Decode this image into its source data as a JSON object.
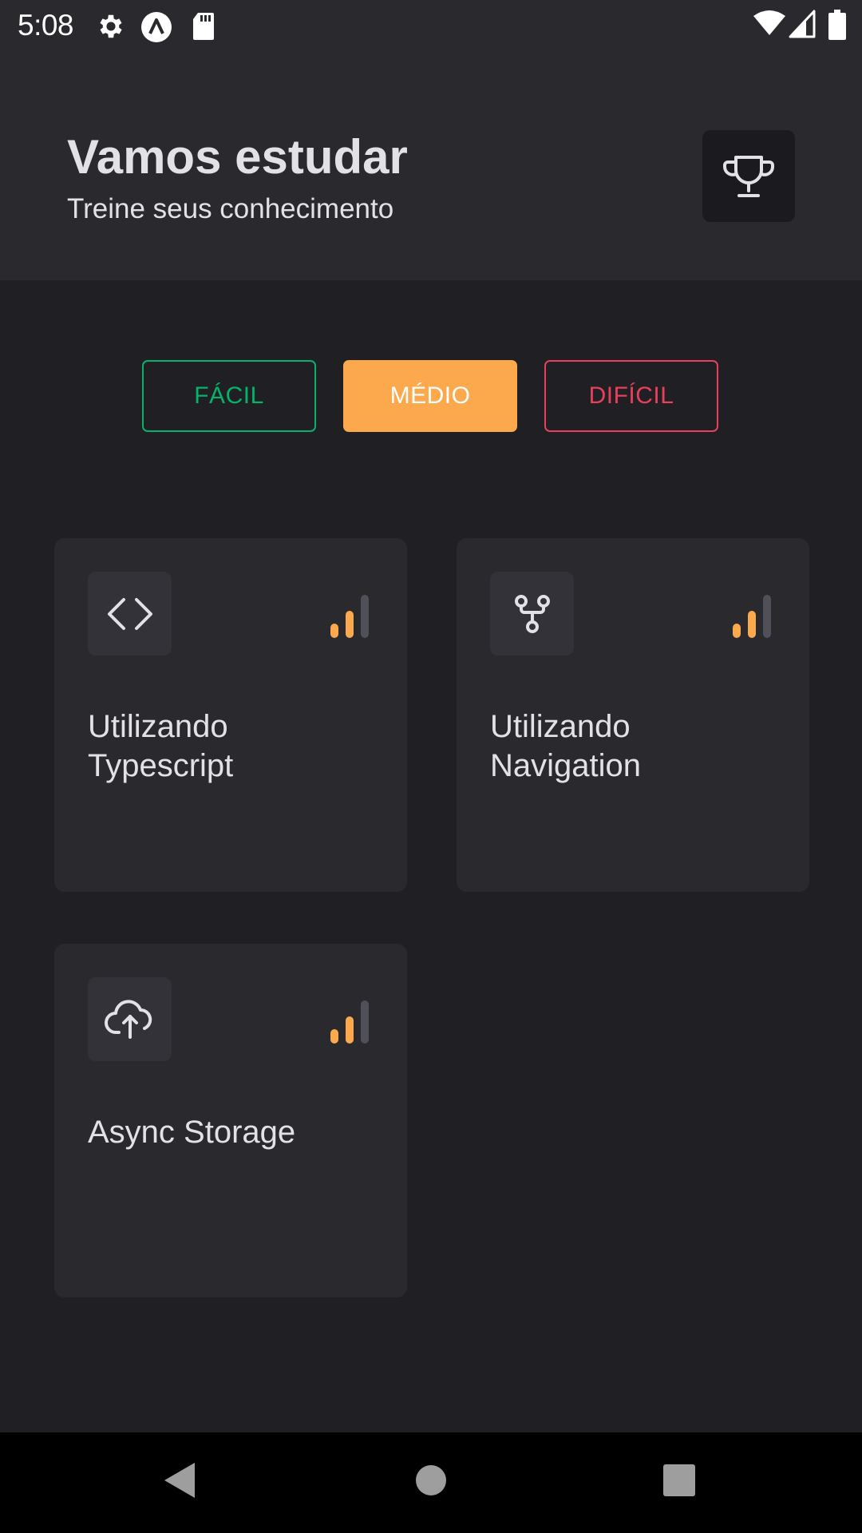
{
  "status_bar": {
    "time": "5:08",
    "icons_left": [
      "gear-icon",
      "app-notification-icon",
      "sd-card-icon"
    ],
    "icons_right": [
      "wifi-icon",
      "cell-signal-icon",
      "battery-icon"
    ]
  },
  "header": {
    "title": "Vamos estudar",
    "subtitle": "Treine seus conhecimento",
    "trophy_icon": "trophy-icon"
  },
  "levels": {
    "easy_label": "FÁCIL",
    "medium_label": "MÉDIO",
    "hard_label": "DIFÍCIL",
    "selected": "MÉDIO"
  },
  "quizzes": [
    {
      "title": "Utilizando Typescript",
      "icon": "code-icon",
      "level_filled": 2,
      "level_total": 3
    },
    {
      "title": "Utilizando Navigation",
      "icon": "git-fork-icon",
      "level_filled": 2,
      "level_total": 3
    },
    {
      "title": "Async Storage",
      "icon": "cloud-upload-icon",
      "level_filled": 2,
      "level_total": 3
    }
  ],
  "colors": {
    "background": "#202024",
    "header": "#29292e",
    "card": "#29292e",
    "easy": "#04b36a",
    "medium": "#fba94c",
    "hard": "#e83f5b",
    "text": "#e1e1e6"
  },
  "nav_bar": {
    "back_icon": "back-triangle-icon",
    "home_icon": "home-circle-icon",
    "recents_icon": "recents-square-icon"
  }
}
